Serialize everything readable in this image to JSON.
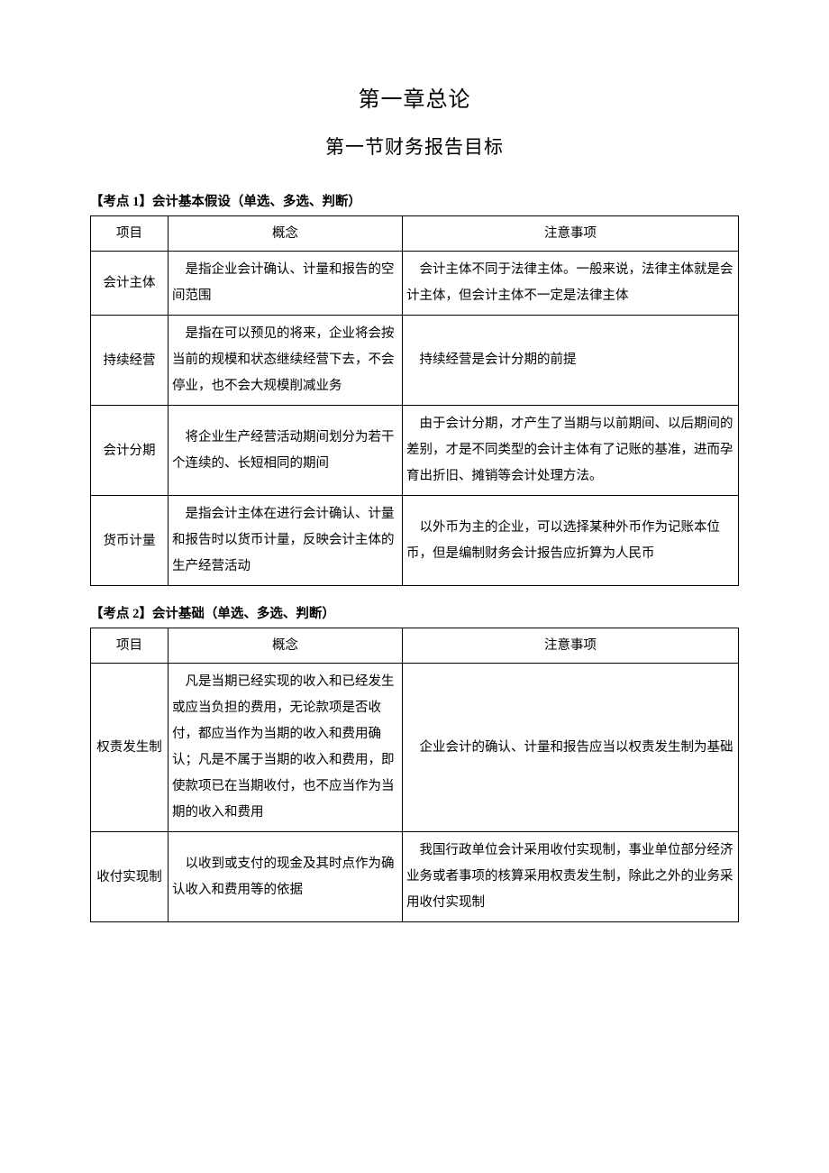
{
  "chapter_title": "第一章总论",
  "section_title": "第一节财务报告目标",
  "point1": {
    "label": "【考点 1】会计基本假设（单选、多选、判断）",
    "headers": {
      "item": "项目",
      "concept": "概念",
      "note": "注意事项"
    },
    "rows": [
      {
        "item": "会计主体",
        "concept": "是指企业会计确认、计量和报告的空间范围",
        "note": "会计主体不同于法律主体。一般来说，法律主体就是会计主体，但会计主体不一定是法律主体"
      },
      {
        "item": "持续经营",
        "concept": "是指在可以预见的将来，企业将会按当前的规模和状态继续经营下去，不会停业，也不会大规模削减业务",
        "note": "持续经营是会计分期的前提"
      },
      {
        "item": "会计分期",
        "concept": "将企业生产经营活动期间划分为若干个连续的、长短相同的期间",
        "note": "由于会计分期，才产生了当期与以前期间、以后期间的差别，才是不同类型的会计主体有了记账的基准，进而孕育出折旧、摊销等会计处理方法。"
      },
      {
        "item": "货币计量",
        "concept": "是指会计主体在进行会计确认、计量和报告时以货币计量，反映会计主体的生产经营活动",
        "note": "以外币为主的企业，可以选择某种外币作为记账本位币，但是编制财务会计报告应折算为人民币"
      }
    ]
  },
  "point2": {
    "label": "【考点 2】会计基础（单选、多选、判断）",
    "headers": {
      "item": "项目",
      "concept": "概念",
      "note": "注意事项"
    },
    "rows": [
      {
        "item": "权责发生制",
        "concept": "凡是当期已经实现的收入和已经发生或应当负担的费用，无论款项是否收付，都应当作为当期的收入和费用确认；凡是不属于当期的收入和费用，即使款项已在当期收付，也不应当作为当期的收入和费用",
        "note": "企业会计的确认、计量和报告应当以权责发生制为基础"
      },
      {
        "item": "收付实现制",
        "concept": "以收到或支付的现金及其时点作为确认收入和费用等的依据",
        "note": "我国行政单位会计采用收付实现制，事业单位部分经济业务或者事项的核算采用权责发生制，除此之外的业务采用收付实现制"
      }
    ]
  }
}
